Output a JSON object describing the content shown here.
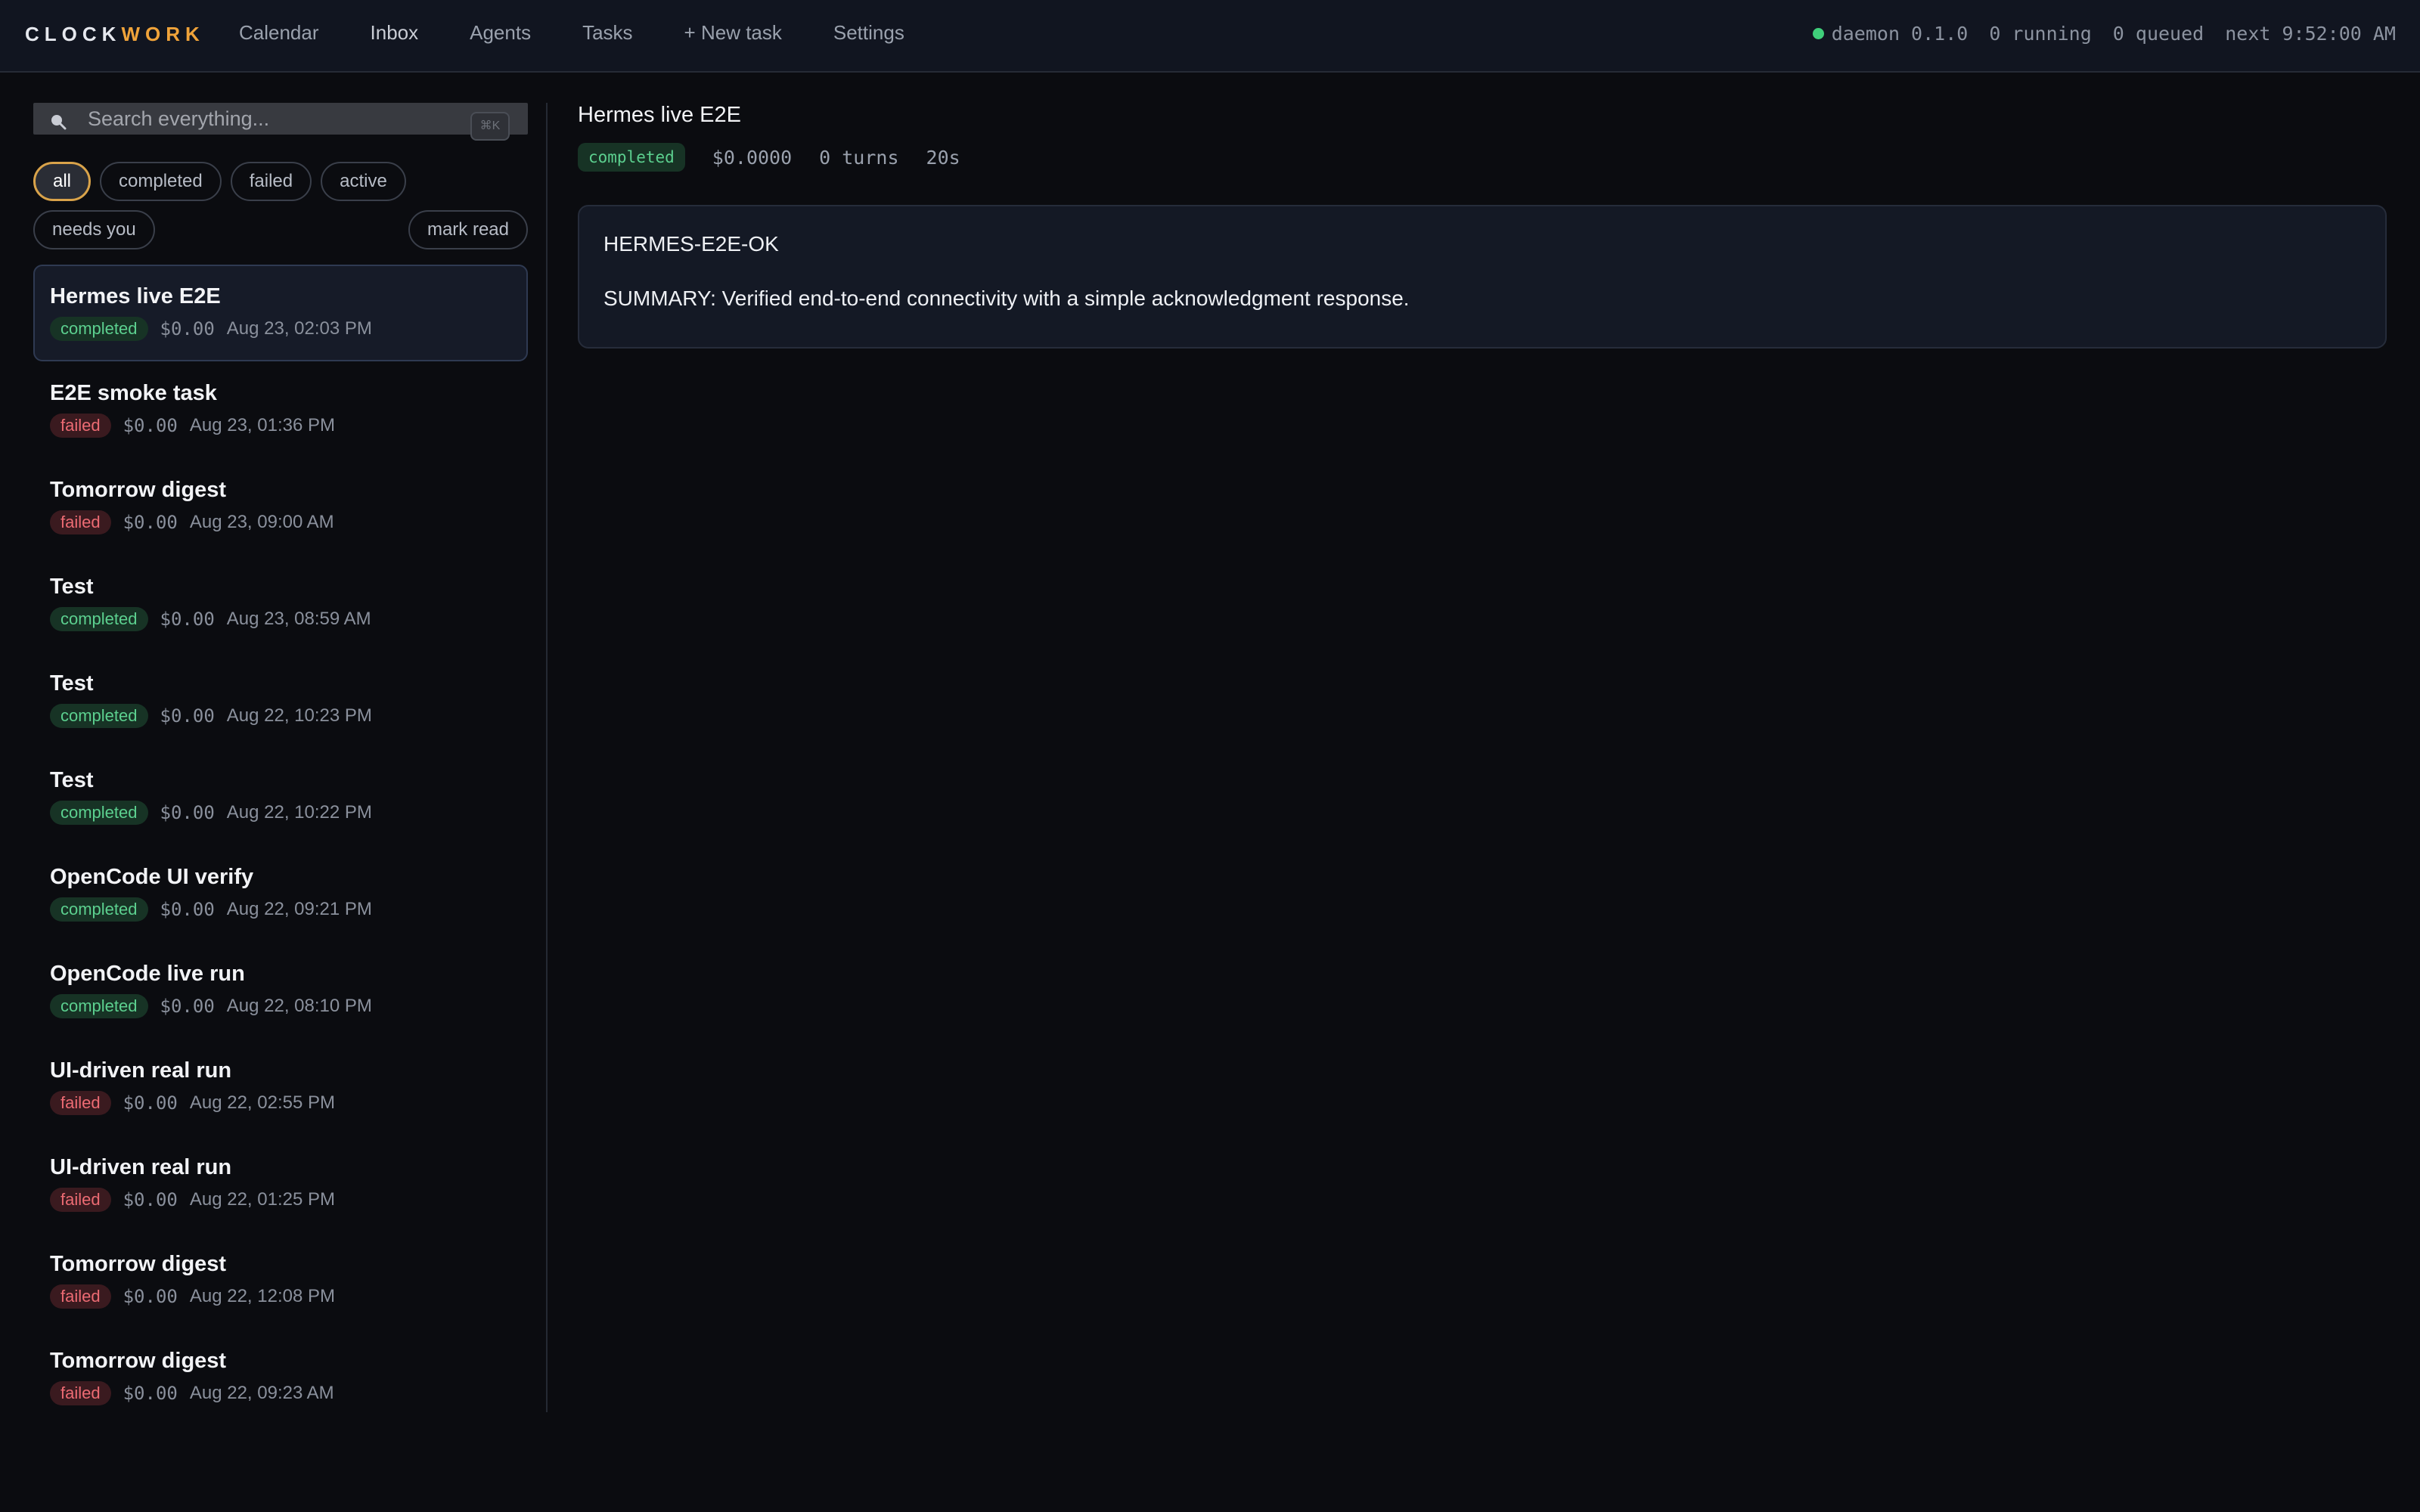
{
  "brand": {
    "part1": "CLOCK",
    "part2": "WORK"
  },
  "nav": {
    "items": [
      {
        "label": "Calendar"
      },
      {
        "label": "Inbox"
      },
      {
        "label": "Agents"
      },
      {
        "label": "Tasks"
      },
      {
        "label": "+ New task"
      },
      {
        "label": "Settings"
      }
    ],
    "active": "Inbox"
  },
  "status": {
    "daemon": "daemon 0.1.0",
    "running": "0 running",
    "queued": "0 queued",
    "next": "next 9:52:00 AM",
    "dot_color": "#3fcf7a"
  },
  "search": {
    "placeholder": "Search everything...",
    "shortcut": "⌘K"
  },
  "filters": {
    "chips": [
      "all",
      "completed",
      "failed",
      "active"
    ],
    "active": "all",
    "needs_you": "needs you",
    "mark_read": "mark read"
  },
  "tasks": [
    {
      "title": "Hermes live E2E",
      "status": "completed",
      "cost": "$0.00",
      "time": "Aug 23, 02:03 PM",
      "selected": true
    },
    {
      "title": "E2E smoke task",
      "status": "failed",
      "cost": "$0.00",
      "time": "Aug 23, 01:36 PM"
    },
    {
      "title": "Tomorrow digest",
      "status": "failed",
      "cost": "$0.00",
      "time": "Aug 23, 09:00 AM"
    },
    {
      "title": "Test",
      "status": "completed",
      "cost": "$0.00",
      "time": "Aug 23, 08:59 AM"
    },
    {
      "title": "Test",
      "status": "completed",
      "cost": "$0.00",
      "time": "Aug 22, 10:23 PM"
    },
    {
      "title": "Test",
      "status": "completed",
      "cost": "$0.00",
      "time": "Aug 22, 10:22 PM"
    },
    {
      "title": "OpenCode UI verify",
      "status": "completed",
      "cost": "$0.00",
      "time": "Aug 22, 09:21 PM"
    },
    {
      "title": "OpenCode live run",
      "status": "completed",
      "cost": "$0.00",
      "time": "Aug 22, 08:10 PM"
    },
    {
      "title": "UI-driven real run",
      "status": "failed",
      "cost": "$0.00",
      "time": "Aug 22, 02:55 PM"
    },
    {
      "title": "UI-driven real run",
      "status": "failed",
      "cost": "$0.00",
      "time": "Aug 22, 01:25 PM"
    },
    {
      "title": "Tomorrow digest",
      "status": "failed",
      "cost": "$0.00",
      "time": "Aug 22, 12:08 PM"
    },
    {
      "title": "Tomorrow digest",
      "status": "failed",
      "cost": "$0.00",
      "time": "Aug 22, 09:23 AM"
    }
  ],
  "detail": {
    "title": "Hermes live E2E",
    "status": "completed",
    "cost": "$0.0000",
    "turns": "0 turns",
    "duration": "20s",
    "output": [
      "HERMES-E2E-OK",
      "SUMMARY: Verified end-to-end connectivity with a simple acknowledgment response."
    ]
  },
  "colors": {
    "accent": "#f0a33a",
    "completed": "#5cd08f",
    "failed": "#ec6b73",
    "background": "#0b0c10"
  }
}
